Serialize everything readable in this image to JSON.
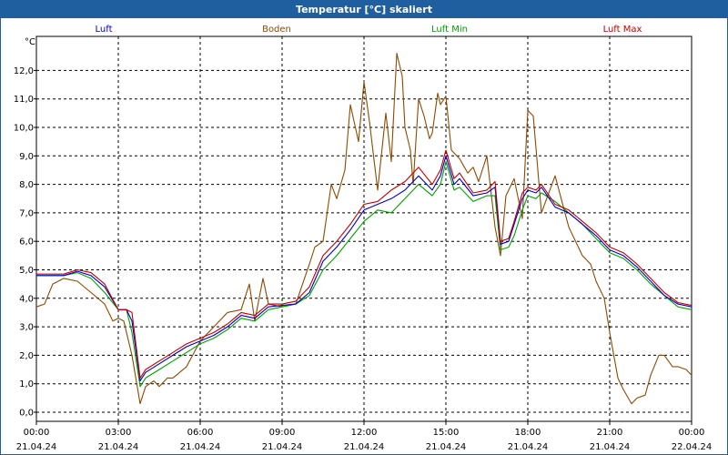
{
  "window": {
    "title": "Temperatur [°C] skaliert"
  },
  "chart_data": {
    "type": "line",
    "title": "Temperatur [°C] skaliert",
    "ylabel": "°C",
    "xlabel": "",
    "ylim": [
      0,
      13
    ],
    "xlim": [
      0,
      24
    ],
    "grid": true,
    "legend_position": "top",
    "y_ticks": [
      "0,0",
      "1,0",
      "2,0",
      "3,0",
      "4,0",
      "5,0",
      "6,0",
      "7,0",
      "8,0",
      "9,0",
      "10,0",
      "11,0",
      "12,0"
    ],
    "x_ticks": [
      {
        "time": "00:00",
        "date": "21.04.24"
      },
      {
        "time": "03:00",
        "date": "21.04.24"
      },
      {
        "time": "06:00",
        "date": "21.04.24"
      },
      {
        "time": "09:00",
        "date": "21.04.24"
      },
      {
        "time": "12:00",
        "date": "21.04.24"
      },
      {
        "time": "15:00",
        "date": "21.04.24"
      },
      {
        "time": "18:00",
        "date": "21.04.24"
      },
      {
        "time": "21:00",
        "date": "21.04.24"
      },
      {
        "time": "00:00",
        "date": "22.04.24"
      }
    ],
    "series": [
      {
        "name": "Boden",
        "color": "#8b4a00",
        "x": [
          0,
          0.3,
          0.6,
          1,
          1.5,
          2,
          2.5,
          2.8,
          3,
          3.2,
          3.5,
          3.8,
          4,
          4.3,
          4.5,
          4.8,
          5,
          5.5,
          6,
          6.5,
          7,
          7.5,
          7.8,
          8,
          8.3,
          8.5,
          9,
          9.5,
          10,
          10.2,
          10.5,
          10.8,
          11,
          11.3,
          11.5,
          11.8,
          12,
          12.2,
          12.5,
          12.8,
          13,
          13.2,
          13.4,
          13.5,
          13.7,
          13.8,
          14,
          14.2,
          14.4,
          14.5,
          14.7,
          14.8,
          15,
          15.2,
          15.5,
          15.8,
          16,
          16.2,
          16.5,
          16.8,
          17,
          17.2,
          17.5,
          17.8,
          18,
          18.2,
          18.5,
          19,
          19.5,
          20,
          20.3,
          20.5,
          20.8,
          21,
          21.3,
          21.5,
          21.8,
          22,
          22.3,
          22.5,
          22.8,
          23,
          23.3,
          23.5,
          23.8,
          24
        ],
        "y": [
          3.7,
          3.8,
          4.5,
          4.7,
          4.6,
          4.2,
          3.8,
          3.2,
          3.3,
          3.2,
          2.0,
          0.3,
          0.9,
          1.1,
          0.9,
          1.2,
          1.2,
          1.6,
          2.5,
          3.0,
          3.5,
          3.6,
          4.5,
          3.2,
          4.7,
          3.8,
          3.7,
          3.8,
          5.2,
          5.8,
          6.0,
          8.0,
          7.5,
          8.5,
          10.8,
          9.5,
          11.6,
          10.2,
          7.8,
          10.5,
          8.8,
          12.6,
          11.8,
          10.0,
          9.2,
          8.0,
          11.0,
          10.4,
          9.6,
          9.8,
          11.2,
          10.8,
          11.1,
          9.2,
          8.9,
          8.4,
          8.6,
          8.1,
          9.0,
          6.5,
          5.5,
          7.6,
          8.2,
          6.8,
          10.6,
          10.4,
          7.0,
          8.3,
          6.5,
          5.5,
          5.2,
          4.6,
          4.0,
          2.8,
          1.2,
          0.8,
          0.3,
          0.5,
          0.6,
          1.3,
          2.0,
          2.0,
          1.6,
          1.6,
          1.5,
          1.3
        ]
      },
      {
        "name": "Luft Min",
        "color": "#00a000",
        "x": [
          0,
          0.5,
          1,
          1.5,
          2,
          2.5,
          3,
          3.3,
          3.5,
          3.8,
          4,
          4.5,
          5,
          5.5,
          6,
          6.5,
          7,
          7.5,
          8,
          8.5,
          9,
          9.5,
          10,
          10.5,
          11,
          11.5,
          12,
          12.5,
          13,
          13.5,
          14,
          14.5,
          14.8,
          15,
          15.3,
          15.5,
          16,
          16.5,
          16.8,
          17,
          17.3,
          17.5,
          17.8,
          18,
          18.3,
          18.5,
          19,
          19.5,
          20,
          20.5,
          21,
          21.5,
          22,
          22.5,
          23,
          23.5,
          24
        ],
        "y": [
          4.8,
          4.8,
          4.8,
          4.9,
          4.7,
          4.2,
          3.6,
          3.6,
          2.8,
          0.9,
          1.2,
          1.5,
          1.8,
          2.1,
          2.4,
          2.6,
          2.9,
          3.3,
          3.2,
          3.6,
          3.7,
          3.8,
          4.1,
          5.0,
          5.5,
          6.1,
          6.7,
          7.1,
          7.0,
          7.5,
          8.0,
          7.6,
          8.0,
          8.8,
          7.8,
          7.9,
          7.4,
          7.6,
          7.6,
          5.7,
          5.8,
          6.2,
          7.1,
          7.6,
          7.5,
          7.7,
          7.4,
          7.0,
          6.6,
          6.1,
          5.6,
          5.4,
          5.0,
          4.5,
          4.1,
          3.7,
          3.6
        ]
      },
      {
        "name": "Luft",
        "color": "#0000c0",
        "x": [
          0,
          0.5,
          1,
          1.5,
          2,
          2.5,
          3,
          3.3,
          3.5,
          3.8,
          4,
          4.5,
          5,
          5.5,
          6,
          6.5,
          7,
          7.5,
          8,
          8.5,
          9,
          9.5,
          10,
          10.5,
          11,
          11.5,
          12,
          12.5,
          13,
          13.5,
          14,
          14.5,
          14.8,
          15,
          15.3,
          15.5,
          16,
          16.5,
          16.8,
          17,
          17.3,
          17.5,
          17.8,
          18,
          18.3,
          18.5,
          19,
          19.5,
          20,
          20.5,
          21,
          21.5,
          22,
          22.5,
          23,
          23.5,
          24
        ],
        "y": [
          4.8,
          4.8,
          4.8,
          4.95,
          4.8,
          4.4,
          3.6,
          3.6,
          3.2,
          1.1,
          1.4,
          1.7,
          2.0,
          2.3,
          2.5,
          2.7,
          3.0,
          3.4,
          3.3,
          3.7,
          3.75,
          3.8,
          4.2,
          5.3,
          5.8,
          6.4,
          7.1,
          7.3,
          7.5,
          7.8,
          8.3,
          7.8,
          8.3,
          9.0,
          8.0,
          8.2,
          7.6,
          7.7,
          7.9,
          5.9,
          6.0,
          6.6,
          7.5,
          7.8,
          7.7,
          7.9,
          7.2,
          7.0,
          6.6,
          6.2,
          5.7,
          5.5,
          5.1,
          4.6,
          4.1,
          3.8,
          3.7
        ]
      },
      {
        "name": "Luft Max",
        "color": "#c00000",
        "x": [
          0,
          0.5,
          1,
          1.5,
          2,
          2.5,
          3,
          3.3,
          3.5,
          3.8,
          4,
          4.5,
          5,
          5.5,
          6,
          6.5,
          7,
          7.5,
          8,
          8.5,
          9,
          9.5,
          10,
          10.5,
          11,
          11.5,
          12,
          12.5,
          13,
          13.5,
          14,
          14.5,
          14.8,
          15,
          15.3,
          15.5,
          16,
          16.5,
          16.8,
          17,
          17.3,
          17.5,
          17.8,
          18,
          18.3,
          18.5,
          19,
          19.5,
          20,
          20.5,
          21,
          21.5,
          22,
          22.5,
          23,
          23.5,
          24
        ],
        "y": [
          4.85,
          4.85,
          4.85,
          5.0,
          4.9,
          4.5,
          3.6,
          3.6,
          3.5,
          1.2,
          1.5,
          1.8,
          2.1,
          2.4,
          2.6,
          2.8,
          3.1,
          3.5,
          3.4,
          3.8,
          3.8,
          3.9,
          4.4,
          5.5,
          6.0,
          6.6,
          7.3,
          7.4,
          7.8,
          8.1,
          8.6,
          8.0,
          8.5,
          9.2,
          8.2,
          8.4,
          7.7,
          7.8,
          8.1,
          6.0,
          6.1,
          6.7,
          7.7,
          7.9,
          7.8,
          8.0,
          7.3,
          7.1,
          6.7,
          6.3,
          5.8,
          5.6,
          5.2,
          4.7,
          4.2,
          3.85,
          3.75
        ]
      }
    ]
  }
}
